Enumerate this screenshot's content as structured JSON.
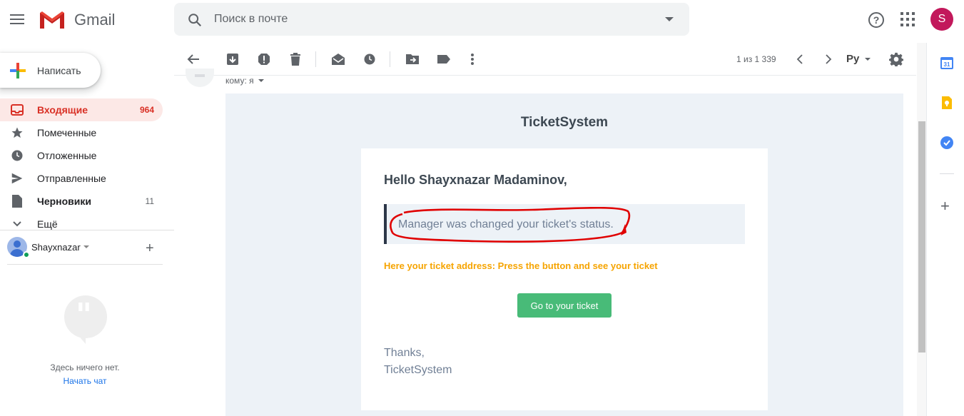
{
  "header": {
    "app_name": "Gmail",
    "search_placeholder": "Поиск в почте",
    "avatar_letter": "S"
  },
  "compose_label": "Написать",
  "nav": {
    "items": [
      {
        "label": "Входящие",
        "count": "964"
      },
      {
        "label": "Помеченные",
        "count": ""
      },
      {
        "label": "Отложенные",
        "count": ""
      },
      {
        "label": "Отправленные",
        "count": ""
      },
      {
        "label": "Черновики",
        "count": "11"
      },
      {
        "label": "Ещё",
        "count": ""
      }
    ]
  },
  "hangouts": {
    "user": "Shayxnazar",
    "empty_text": "Здесь ничего нет.",
    "start_chat": "Начать чат"
  },
  "toolbar": {
    "pager": "1 из 1 339",
    "input_lang": "Ру"
  },
  "message": {
    "to_line": "кому: я"
  },
  "email": {
    "brand": "TicketSystem",
    "greeting": "Hello Shayxnazar Madaminov,",
    "status_text": "Manager was changed your ticket's status.",
    "address_text": "Here your ticket address: Press the button and see your ticket",
    "button_label": "Go to your ticket",
    "thanks": "Thanks,",
    "signature": "TicketSystem"
  },
  "colors": {
    "accent_red": "#d93025",
    "button_green": "#48bb78",
    "address_orange": "#f6a400",
    "annotation_red": "#e00000"
  }
}
